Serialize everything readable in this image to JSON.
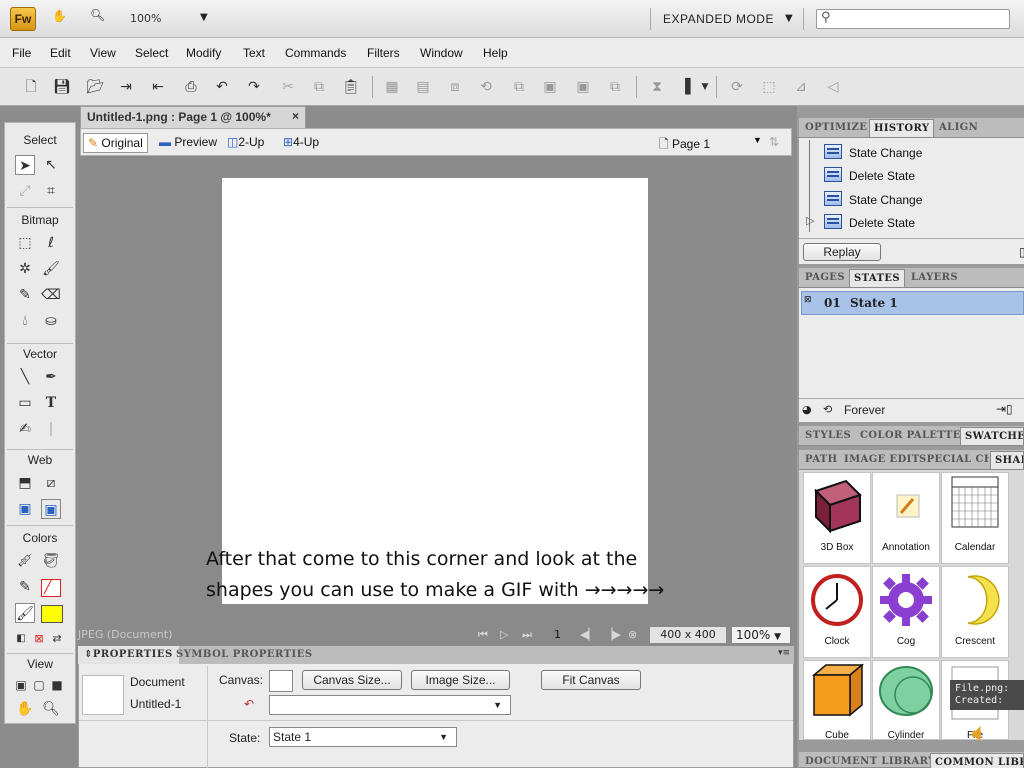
{
  "app": {
    "logo": "Fw",
    "zoom": "100%",
    "mode": "EXPANDED MODE",
    "search_placeholder": ""
  },
  "menu": [
    "File",
    "Edit",
    "View",
    "Select",
    "Modify",
    "Text",
    "Commands",
    "Filters",
    "Window",
    "Help"
  ],
  "tools": {
    "sections": [
      "Select",
      "Bitmap",
      "Vector",
      "Web",
      "Colors",
      "View"
    ],
    "stroke_color": "#e02020",
    "fill_color": "#ffff00"
  },
  "document": {
    "tab_title": "Untitled-1.png : Page 1 @ 100%*",
    "close": "×",
    "views": [
      "Original",
      "Preview",
      "2-Up",
      "4-Up"
    ],
    "page": "Page 1",
    "status_doc": "JPEG (Document)",
    "frame": "1",
    "size": "400 x 400",
    "zoom": "100%"
  },
  "annotation": {
    "line1": "After that come to this corner and look at the",
    "line2": "shapes you can use to make a GIF with →→→→→"
  },
  "properties": {
    "tabs": [
      "PROPERTIES",
      "SYMBOL PROPERTIES"
    ],
    "doc_label": "Document",
    "doc_name": "Untitled-1",
    "canvas_label": "Canvas:",
    "canvas_size_btn": "Canvas Size...",
    "image_size_btn": "Image Size...",
    "fit_canvas_btn": "Fit Canvas",
    "state_label": "State:",
    "state_value": "State 1"
  },
  "history": {
    "tabs": [
      "OPTIMIZE",
      "HISTORY",
      "ALIGN"
    ],
    "items": [
      "State Change",
      "Delete State",
      "State Change",
      "Delete State"
    ],
    "replay": "Replay"
  },
  "states": {
    "tabs": [
      "PAGES",
      "STATES",
      "LAYERS"
    ],
    "row_num": "01",
    "row_name": "State 1",
    "loop": "Forever"
  },
  "styles_tabs": [
    "STYLES",
    "COLOR PALETTE",
    "SWATCHES"
  ],
  "shapes": {
    "tabs": [
      "PATH",
      "IMAGE EDIT",
      "SPECIAL CH",
      "SHAPES"
    ],
    "items": [
      "3D Box",
      "Annotation",
      "Calendar",
      "Clock",
      "Cog",
      "Crescent",
      "Cube",
      "Cylinder",
      "File"
    ],
    "tooltip_line1": "File.png:",
    "tooltip_line2": "Created:"
  },
  "library_tabs": [
    "DOCUMENT LIBRARY",
    "COMMON LIBRARY"
  ]
}
